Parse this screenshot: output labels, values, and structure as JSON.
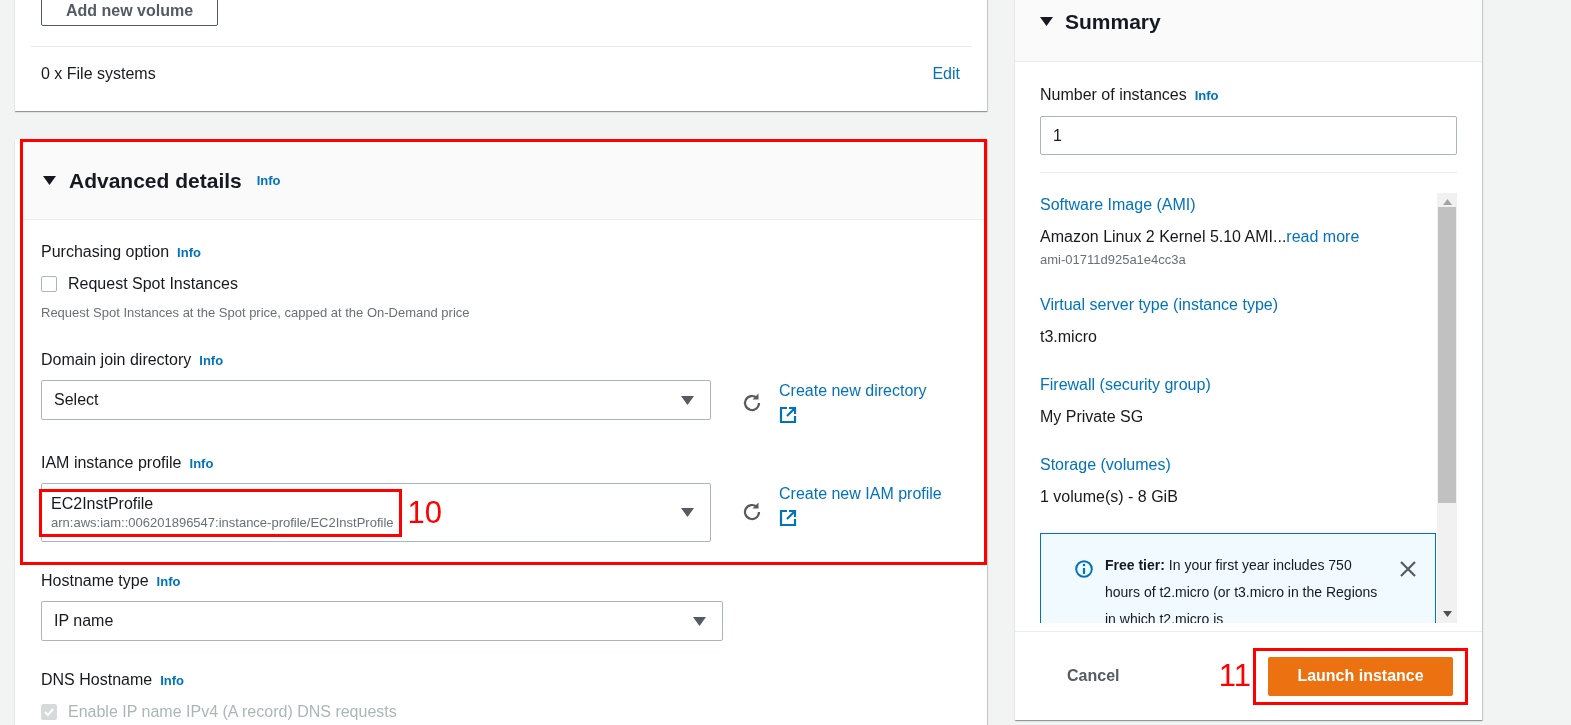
{
  "storage_card": {
    "add_volume_button": "Add new volume",
    "file_systems": "0 x File systems",
    "edit_link": "Edit"
  },
  "advanced_details": {
    "title": "Advanced details",
    "info": "Info",
    "expanded": true,
    "fields": [
      {
        "kind": "checkbox",
        "label": "Purchasing option",
        "info": "Info",
        "option": "Request Spot Instances",
        "checked": false,
        "disabled": false,
        "description": "Request Spot Instances at the Spot price, capped at the On-Demand price",
        "highlighted": true
      },
      {
        "kind": "select",
        "label": "Domain join directory",
        "info": "Info",
        "value": "Select",
        "link": "Create new directory",
        "highlighted": true
      },
      {
        "kind": "select",
        "label": "IAM instance profile",
        "info": "Info",
        "value": "EC2InstProfile",
        "description": "arn:aws:iam::006201896547:instance-profile/EC2InstProfile",
        "link": "Create new IAM profile",
        "annotation": "10",
        "highlighted": true
      },
      {
        "kind": "select",
        "label": "Hostname type",
        "info": "Info",
        "value": "IP name",
        "highlighted": false
      },
      {
        "kind": "checkbox",
        "label": "DNS Hostname",
        "info": "Info",
        "option": "Enable IP name IPv4 (A record) DNS requests",
        "checked": true,
        "disabled": true,
        "highlighted": false
      }
    ]
  },
  "summary": {
    "title": "Summary",
    "expanded": true,
    "instances": {
      "label": "Number of instances",
      "info": "Info",
      "value": "1"
    },
    "items": [
      {
        "title": "Software Image (AMI)",
        "value": "Amazon Linux 2 Kernel 5.10 AMI...",
        "link": "read more",
        "detail": "ami-01711d925a1e4cc3a"
      },
      {
        "title": "Virtual server type (instance type)",
        "value": "t3.micro"
      },
      {
        "title": "Firewall (security group)",
        "value": "My Private SG"
      },
      {
        "title": "Storage (volumes)",
        "value": "1 volume(s) - 8 GiB"
      }
    ],
    "free_tier": "**Free tier:** In your first year includes 750 hours of t2.micro (or t3.micro in the Regions in which t2.micro is",
    "cancel": "Cancel",
    "launch": "Launch instance",
    "annotation": "11"
  }
}
